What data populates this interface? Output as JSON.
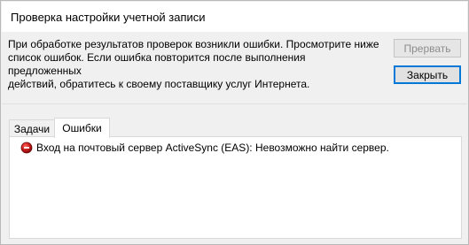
{
  "window": {
    "title": "Проверка настройки учетной записи"
  },
  "message": {
    "line1": "При обработке результатов проверок возникли ошибки. Просмотрите ниже",
    "line2": "список ошибок. Если ошибка повторится после выполнения предложенных",
    "line3": "действий, обратитесь к своему поставщику услуг Интернета."
  },
  "buttons": {
    "abort_label": "Прервать",
    "abort_enabled": false,
    "close_label": "Закрыть"
  },
  "tabs": [
    {
      "label": "Задачи",
      "active": false
    },
    {
      "label": "Ошибки",
      "active": true
    }
  ],
  "errors": [
    {
      "icon": "error-icon",
      "text": "Вход на почтовый сервер ActiveSync (EAS): Невозможно найти сервер."
    }
  ],
  "colors": {
    "error_icon": "#c81a1a",
    "focus_border": "#0078d7"
  }
}
